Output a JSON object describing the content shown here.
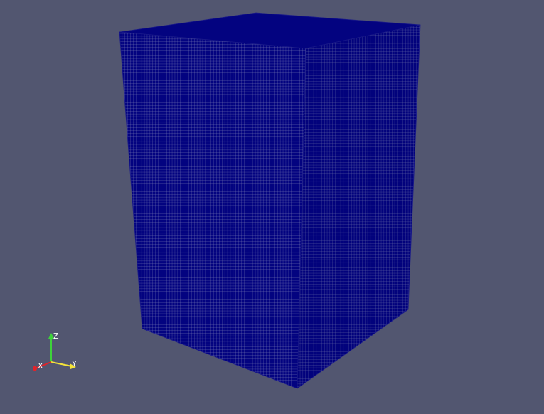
{
  "scene": {
    "background_color": "#525670",
    "object": {
      "name": "box-mesh",
      "representation": "surface-with-edges",
      "surface_color": "#030380",
      "edge_color": "#a7a9c6",
      "faces": [
        "top-face",
        "left-face",
        "right-face"
      ]
    }
  },
  "orientation_axes": {
    "x_label": "X",
    "y_label": "Y",
    "z_label": "Z",
    "x_color": "#e3232a",
    "y_color": "#f4e33a",
    "z_color": "#3ed33a"
  }
}
